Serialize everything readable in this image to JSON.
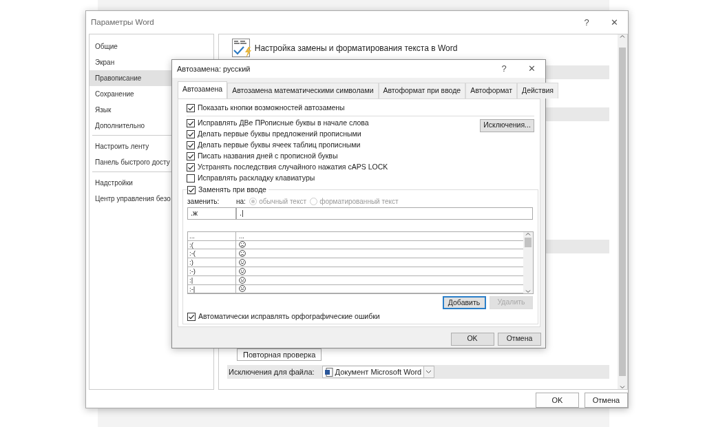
{
  "options_window": {
    "title": "Параметры Word",
    "help": "?",
    "close": "✕",
    "sidebar": {
      "groups": [
        {
          "items": [
            {
              "label": "Общие",
              "selected": false
            },
            {
              "label": "Экран",
              "selected": false
            },
            {
              "label": "Правописание",
              "selected": true
            },
            {
              "label": "Сохранение",
              "selected": false
            },
            {
              "label": "Язык",
              "selected": false
            },
            {
              "label": "Дополнительно",
              "selected": false
            }
          ]
        },
        {
          "items": [
            {
              "label": "Настроить ленту",
              "selected": false
            },
            {
              "label": "Панель быстрого досту",
              "selected": false
            }
          ]
        },
        {
          "items": [
            {
              "label": "Надстройки",
              "selected": false
            },
            {
              "label": "Центр управления безо",
              "selected": false
            }
          ]
        }
      ]
    },
    "header": "Настройка замены и форматирования текста в Word",
    "recheck_button": "Повторная проверка",
    "file_exceptions": {
      "label": "Исключения для файла:",
      "value": "Документ Microsoft Word"
    },
    "buttons": [
      "OK",
      "Отмена"
    ]
  },
  "autocorrect_dialog": {
    "title": "Автозамена: русский",
    "help": "?",
    "close": "✕",
    "tabs": [
      {
        "label": "Автозамена",
        "selected": true
      },
      {
        "label": "Автозамена математическими символами",
        "selected": false
      },
      {
        "label": "Автоформат при вводе",
        "selected": false
      },
      {
        "label": "Автоформат",
        "selected": false
      },
      {
        "label": "Действия",
        "selected": false
      }
    ],
    "show_buttons": {
      "label": "Показать кнопки возможностей автозамены",
      "checked": true
    },
    "options": [
      {
        "label": "Исправлять ДВе ПРописные буквы в начале слова",
        "checked": true
      },
      {
        "label": "Делать первые буквы предложений прописными",
        "checked": true
      },
      {
        "label": "Делать первые буквы ячеек таблиц прописными",
        "checked": true
      },
      {
        "label": "Писать названия дней с прописной буквы",
        "checked": true
      },
      {
        "label": "Устранять последствия случайного нажатия cAPS LOCK",
        "checked": true
      },
      {
        "label": "Исправлять раскладку клавиатуры",
        "checked": false
      }
    ],
    "exceptions_button": "Исключения...",
    "replace_as_typed": {
      "label": "Заменять при вводе",
      "checked": true
    },
    "replace_label": "заменить:",
    "with_label": "на:",
    "format_options": [
      {
        "label": "обычный текст",
        "selected": true,
        "disabled": true
      },
      {
        "label": "форматированный текст",
        "selected": false,
        "disabled": true
      }
    ],
    "replace_value": ".ж",
    "with_value": ".|",
    "entries": [
      {
        "from": "...",
        "kind": "text",
        "to": "..."
      },
      {
        "from": ":(",
        "kind": "sad"
      },
      {
        "from": ":-(",
        "kind": "sad"
      },
      {
        "from": ":)",
        "kind": "smile"
      },
      {
        "from": ":-)",
        "kind": "smile"
      },
      {
        "from": ":|",
        "kind": "neutral"
      },
      {
        "from": ":-|",
        "kind": "neutral"
      }
    ],
    "add_button": {
      "label": "Добавить",
      "disabled": false
    },
    "delete_button": {
      "label": "Удалить",
      "disabled": true
    },
    "auto_spelling": {
      "label": "Автоматически исправлять орфографические ошибки",
      "checked": true
    },
    "buttons": [
      "OK",
      "Отмена"
    ]
  }
}
